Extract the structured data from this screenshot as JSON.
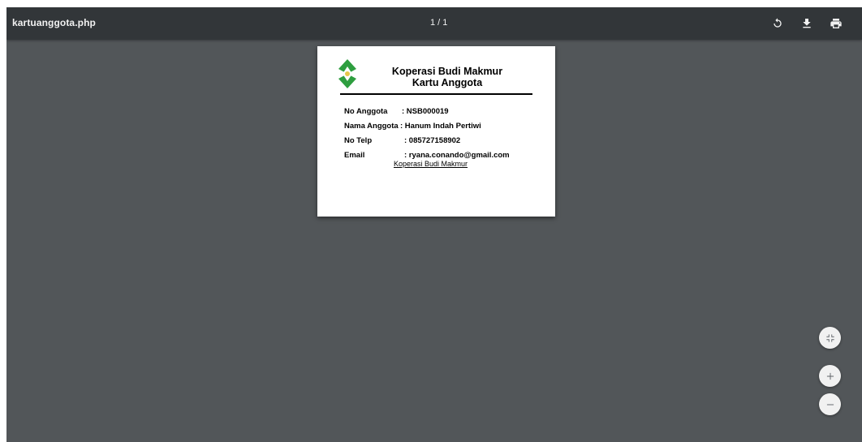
{
  "toolbar": {
    "filename": "kartuanggota.php",
    "page_indicator": "1 / 1",
    "rotate_icon": "rotate-icon",
    "download_icon": "download-icon",
    "print_icon": "print-icon"
  },
  "card": {
    "org_name": "Koperasi Budi Makmur",
    "card_title": "Kartu Anggota",
    "fields": [
      {
        "label": "No Anggota",
        "value": ": NSB000019"
      },
      {
        "label": "Nama Anggota",
        "value": ": Hanum Indah Pertiwi"
      },
      {
        "label": "No Telp",
        "value": ": 085727158902"
      },
      {
        "label": "Email",
        "value": ": ryana.conando@gmail.com"
      }
    ],
    "footer_link": "Koperasi Budi Makmur"
  },
  "zoom_controls": {
    "fit_icon": "fit-to-page-icon",
    "zoom_in_icon": "plus-icon",
    "zoom_out_icon": "minus-icon"
  },
  "colors": {
    "toolbar_bg": "#323639",
    "viewer_bg": "#525659",
    "logo_green": "#2e9e3f"
  }
}
